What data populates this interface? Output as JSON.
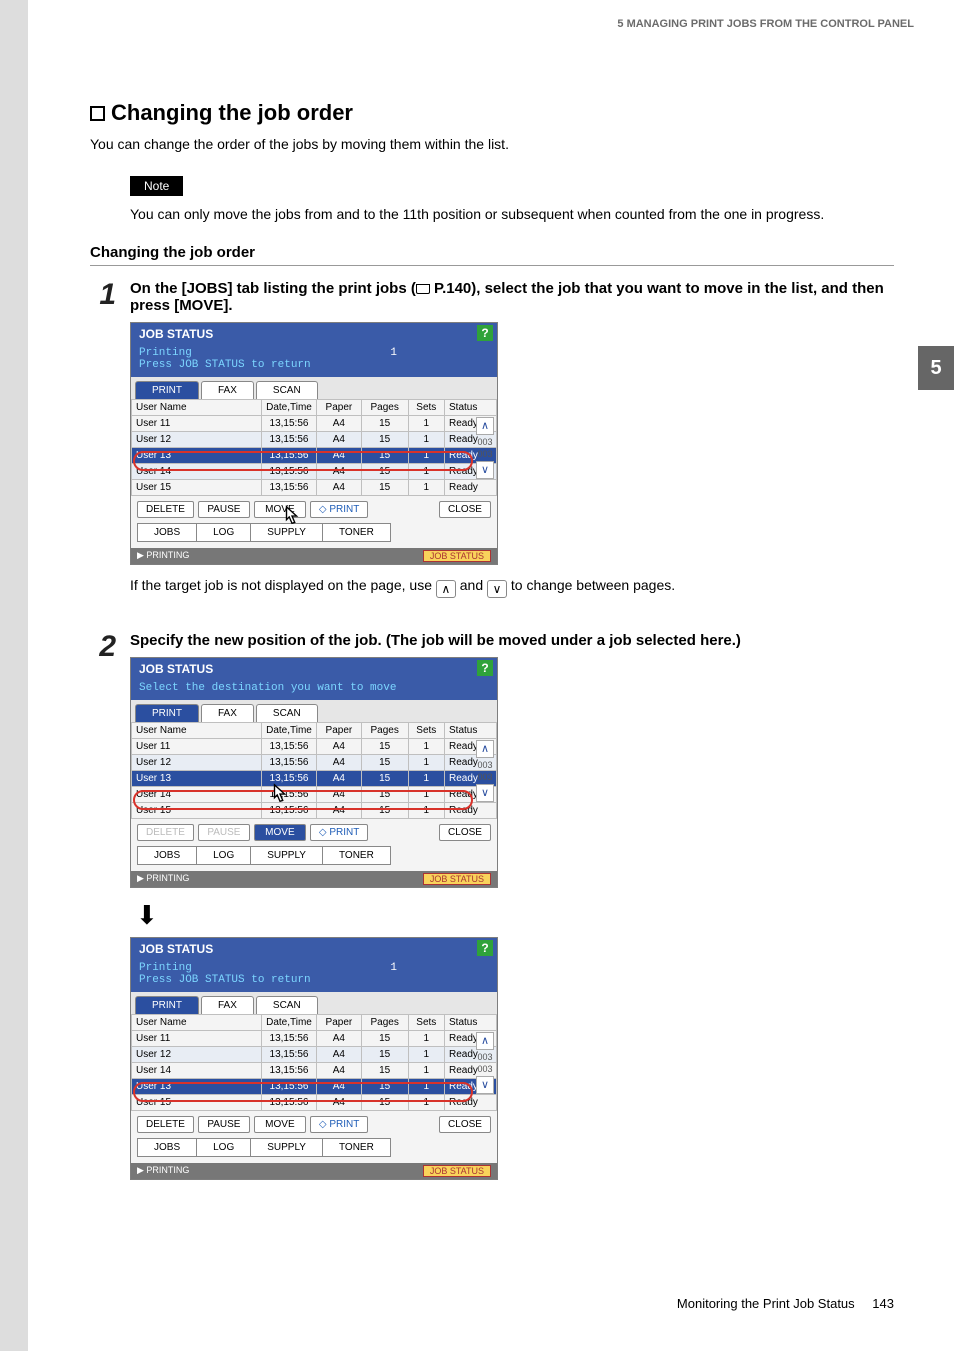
{
  "header": "5 MANAGING PRINT JOBS FROM THE CONTROL PANEL",
  "side_tab": "5",
  "section_title": "Changing the job order",
  "intro": "You can change the order of the jobs by moving them within the list.",
  "note_label": "Note",
  "note_text": "You can only move the jobs from and to the 11th position or subsequent when counted from the one in progress.",
  "subheading": "Changing the job order",
  "step1": {
    "num": "1",
    "title_a": "On the [JOBS] tab listing the print jobs (",
    "title_b": " P.140), select the job that you want to move in the list, and then press [MOVE]."
  },
  "post1_a": "If the target job is not displayed on the page, use ",
  "post1_mid": " and ",
  "post1_b": " to change between pages.",
  "step2": {
    "num": "2",
    "title": "Specify the new position of the job. (The job will be moved under a job selected here.)"
  },
  "footer_text": "Monitoring the Print Job Status",
  "footer_page": "143",
  "panel_common": {
    "title": "JOB STATUS",
    "help": "?",
    "tabs": [
      "PRINT",
      "FAX",
      "SCAN"
    ],
    "cols": [
      "User Name",
      "Date,Time",
      "Paper",
      "Pages",
      "Sets",
      "Status"
    ],
    "btns": {
      "delete": "DELETE",
      "pause": "PAUSE",
      "move": "MOVE",
      "print": "PRINT",
      "close": "CLOSE"
    },
    "tabs2": [
      "JOBS",
      "LOG",
      "SUPPLY",
      "TONER"
    ],
    "footer_left": "PRINTING",
    "footer_btn": "JOB STATUS",
    "scroll": {
      "top": "003",
      "bot": "003"
    }
  },
  "panel1": {
    "sub_a": "Printing",
    "sub_b": "Press JOB STATUS to return",
    "count": "1",
    "rows": [
      {
        "u": "User 11",
        "d": "13,15:56",
        "pa": "A4",
        "pg": "15",
        "s": "1",
        "st": "Ready",
        "cls": ""
      },
      {
        "u": "User 12",
        "d": "13,15:56",
        "pa": "A4",
        "pg": "15",
        "s": "1",
        "st": "Ready",
        "cls": "shade"
      },
      {
        "u": "User 13",
        "d": "13,15:56",
        "pa": "A4",
        "pg": "15",
        "s": "1",
        "st": "Ready",
        "cls": "sel"
      },
      {
        "u": "User 14",
        "d": "13,15:56",
        "pa": "A4",
        "pg": "15",
        "s": "1",
        "st": "Ready",
        "cls": "shade"
      },
      {
        "u": "User 15",
        "d": "13,15:56",
        "pa": "A4",
        "pg": "15",
        "s": "1",
        "st": "Ready",
        "cls": ""
      }
    ]
  },
  "panel2": {
    "sub_a": "Select the destination you want to move",
    "rows": [
      {
        "u": "User 11",
        "d": "13,15:56",
        "pa": "A4",
        "pg": "15",
        "s": "1",
        "st": "Ready",
        "cls": ""
      },
      {
        "u": "User 12",
        "d": "13,15:56",
        "pa": "A4",
        "pg": "15",
        "s": "1",
        "st": "Ready",
        "cls": "shade"
      },
      {
        "u": "User 13",
        "d": "13,15:56",
        "pa": "A4",
        "pg": "15",
        "s": "1",
        "st": "Ready",
        "cls": "sel"
      },
      {
        "u": "User 14",
        "d": "13,15:56",
        "pa": "A4",
        "pg": "15",
        "s": "1",
        "st": "Ready",
        "cls": ""
      },
      {
        "u": "User 15",
        "d": "13,15:56",
        "pa": "A4",
        "pg": "15",
        "s": "1",
        "st": "Ready",
        "cls": ""
      }
    ]
  },
  "panel3": {
    "sub_a": "Printing",
    "sub_b": "Press JOB STATUS to return",
    "count": "1",
    "rows": [
      {
        "u": "User 11",
        "d": "13,15:56",
        "pa": "A4",
        "pg": "15",
        "s": "1",
        "st": "Ready",
        "cls": ""
      },
      {
        "u": "User 12",
        "d": "13,15:56",
        "pa": "A4",
        "pg": "15",
        "s": "1",
        "st": "Ready",
        "cls": "shade"
      },
      {
        "u": "User 14",
        "d": "13,15:56",
        "pa": "A4",
        "pg": "15",
        "s": "1",
        "st": "Ready",
        "cls": ""
      },
      {
        "u": "User 13",
        "d": "13,15:56",
        "pa": "A4",
        "pg": "15",
        "s": "1",
        "st": "Ready",
        "cls": "sel"
      },
      {
        "u": "User 15",
        "d": "13,15:56",
        "pa": "A4",
        "pg": "15",
        "s": "1",
        "st": "Ready",
        "cls": ""
      }
    ]
  }
}
